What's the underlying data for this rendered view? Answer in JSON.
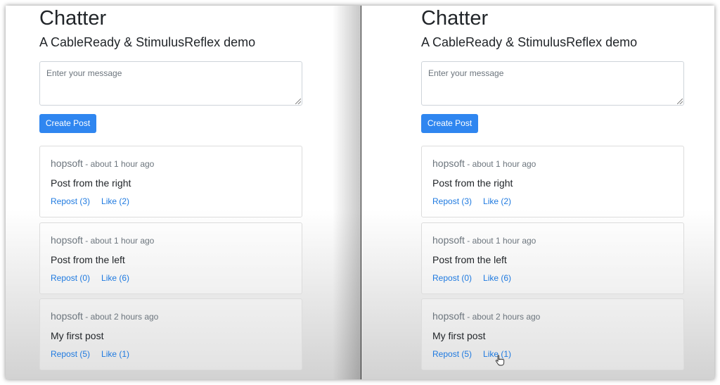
{
  "panes": [
    {
      "title": "Chatter",
      "subtitle": "A CableReady & StimulusReflex demo",
      "message_placeholder": "Enter your message",
      "create_button": "Create Post",
      "posts": [
        {
          "author": "hopsoft",
          "separator": " - ",
          "time": "about 1 hour ago",
          "body": "Post from the right",
          "repost": "Repost (3)",
          "like": "Like (2)"
        },
        {
          "author": "hopsoft",
          "separator": " - ",
          "time": "about 1 hour ago",
          "body": "Post from the left",
          "repost": "Repost (0)",
          "like": "Like (6)"
        },
        {
          "author": "hopsoft",
          "separator": " - ",
          "time": "about 2 hours ago",
          "body": "My first post",
          "repost": "Repost (5)",
          "like": "Like (1)"
        }
      ]
    },
    {
      "title": "Chatter",
      "subtitle": "A CableReady & StimulusReflex demo",
      "message_placeholder": "Enter your message",
      "create_button": "Create Post",
      "posts": [
        {
          "author": "hopsoft",
          "separator": " - ",
          "time": "about 1 hour ago",
          "body": "Post from the right",
          "repost": "Repost (3)",
          "like": "Like (2)"
        },
        {
          "author": "hopsoft",
          "separator": " - ",
          "time": "about 1 hour ago",
          "body": "Post from the left",
          "repost": "Repost (0)",
          "like": "Like (6)"
        },
        {
          "author": "hopsoft",
          "separator": " - ",
          "time": "about 2 hours ago",
          "body": "My first post",
          "repost": "Repost (5)",
          "like": "Like (1)"
        }
      ]
    }
  ],
  "colors": {
    "button": "#2f86f0",
    "link": "#1f7ae0",
    "text": "#212529",
    "muted": "#6c757d"
  }
}
